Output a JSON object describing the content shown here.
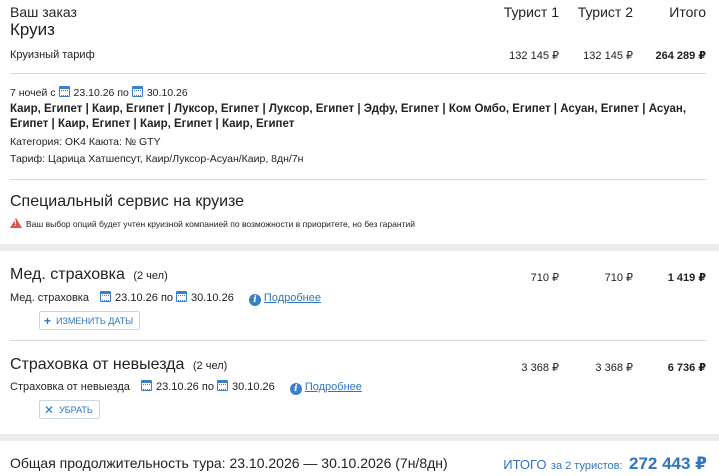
{
  "header": {
    "order_label": "Ваш заказ",
    "cruise_title": "Круиз",
    "col1": "Турист 1",
    "col2": "Турист 2",
    "col3": "Итого"
  },
  "tariff_row": {
    "label": "Круизный тариф",
    "t1": "132 145 ₽",
    "t2": "132 145 ₽",
    "total": "264 289 ₽"
  },
  "cruise": {
    "nights_prefix": "7 ночей с",
    "date_from": "23.10.26",
    "by": "по",
    "date_to": "30.10.26",
    "route_line1": "Каир, Египет | Каир, Египет | Луксор, Египет | Луксор, Египет | Эдфу, Египет | Ком Омбо, Египет | Асуан, Египет | Асуан,",
    "route_line2": "Египет | Каир, Египет | Каир, Египет | Каир, Египет",
    "category": "Категория: OK4  Каюта: № GTY",
    "tariff": "Тариф: Царица Хатшепсут, Каир/Луксор-Асуан/Каир, 8дн/7н"
  },
  "special": {
    "title": "Специальный сервис на круизе",
    "warning": "Ваш выбор опций будет учтен круизной компанией по возможности в приоритете, но без гарантий"
  },
  "med": {
    "title": "Мед. страховка",
    "count": "(2 чел)",
    "t1": "710 ₽",
    "t2": "710 ₽",
    "total": "1 419 ₽",
    "sub_label": "Мед. страховка",
    "date_from": "23.10.26",
    "by": "по",
    "date_to": "30.10.26",
    "more_link": "Подробнее",
    "button": "ИЗМЕНИТЬ ДАТЫ"
  },
  "nonexit": {
    "title": "Страховка от невыезда",
    "count": "(2 чел)",
    "t1": "3 368 ₽",
    "t2": "3 368 ₽",
    "total": "6 736 ₽",
    "sub_label": "Страховка от невыезда",
    "date_from": "23.10.26",
    "by": "по",
    "date_to": "30.10.26",
    "more_link": "Подробнее",
    "button": "УБРАТЬ"
  },
  "footer": {
    "duration": "Общая продолжительность тура: 23.10.2026 — 30.10.2026 (7н/8дн)",
    "total_label": "ИТОГО",
    "total_for": "за 2 туристов:",
    "total_value": "272 443 ₽"
  },
  "icons": [
    "calendar-icon",
    "info-icon",
    "plus-icon",
    "close-icon",
    "warning-icon"
  ],
  "colors": {
    "accent": "#2f74c0",
    "warning": "#d9534f",
    "background": "#ebebeb"
  }
}
